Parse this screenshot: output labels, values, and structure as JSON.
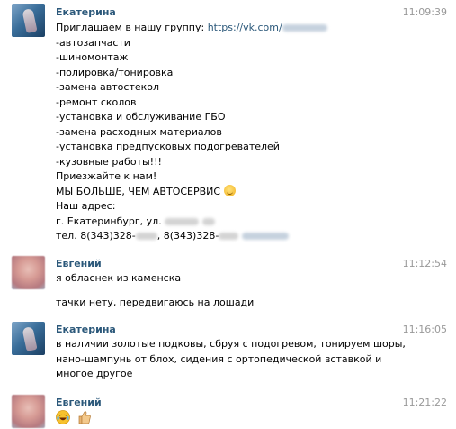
{
  "messages": [
    {
      "author": "Екатерина",
      "time": "11:09:39",
      "lines": [
        "Приглашаем в нашу группу: ",
        "-автозапчасти",
        "-шиномонтаж",
        "-полировка/тонировка",
        "-замена автостекол",
        "-ремонт сколов",
        "-установка и обслуживание ГБО",
        "-замена расходных материалов",
        "-установка предпусковых подогревателей",
        "-кузовные работы!!!",
        "Приезжайте к нам!",
        "МЫ БОЛЬШЕ, ЧЕМ АВТОСЕРВИС",
        "Наш адрес:",
        "г. Екатеринбург, ул.",
        "тел. 8(343)328-",
        ", 8(343)328-"
      ],
      "link": "https://vk.com/"
    },
    {
      "author": "Евгений",
      "time": "11:12:54",
      "lines": [
        "я обласнек из каменска",
        "тачки нету, передвигаюсь на лошади"
      ]
    },
    {
      "author": "Екатерина",
      "time": "11:16:05",
      "lines": [
        "в наличии золотые подковы, сбруя с подогревом, тонируем шоры,",
        "нано-шампунь от блох, сидения с ортопедической вставкой и",
        "многое другое"
      ]
    },
    {
      "author": "Евгений",
      "time": "11:21:22",
      "emojis": [
        "laughing-crying-emoji",
        "thumbs-up-emoji"
      ]
    }
  ],
  "colors": {
    "author": "#2b587a",
    "time": "#999999",
    "link": "#2b587a",
    "text": "#000000"
  }
}
